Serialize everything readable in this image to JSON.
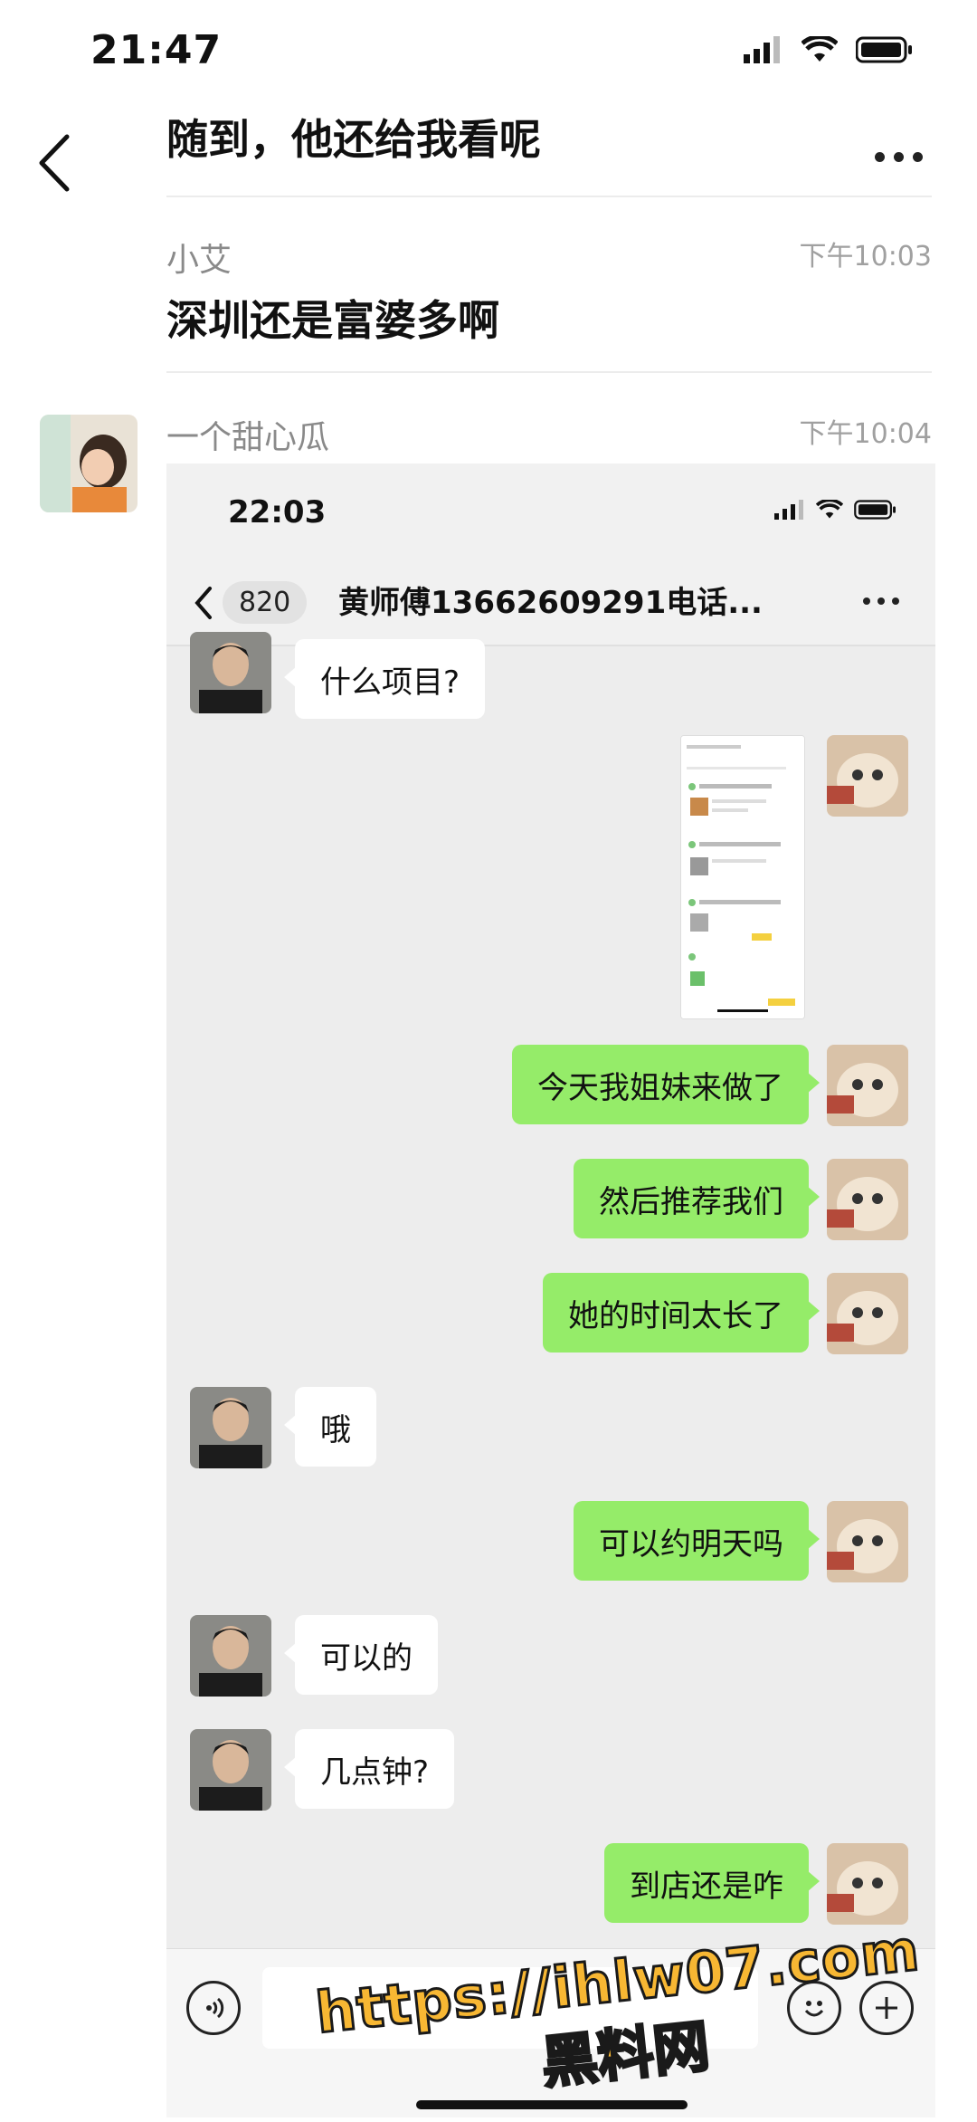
{
  "status_bar": {
    "time": "21:47"
  },
  "header": {
    "title": "随到，他还给我看呢"
  },
  "messages": [
    {
      "sender": "小艾",
      "time": "下午10:03",
      "text": "深圳还是富婆多啊"
    },
    {
      "sender": "一个甜心瓜",
      "time": "下午10:04"
    }
  ],
  "screenshot": {
    "time": "22:03",
    "back_count": "820",
    "title": "黄师傅13662609291电话...",
    "chat": [
      {
        "from": "other",
        "text": "什么项目?"
      },
      {
        "from": "me",
        "text": "今天我姐妹来做了"
      },
      {
        "from": "me",
        "text": "然后推荐我们"
      },
      {
        "from": "me",
        "text": "她的时间太长了"
      },
      {
        "from": "other",
        "text": "哦"
      },
      {
        "from": "me",
        "text": "可以约明天吗"
      },
      {
        "from": "other",
        "text": "可以的"
      },
      {
        "from": "other",
        "text": "几点钟?"
      },
      {
        "from": "me",
        "text": "到店还是咋"
      }
    ]
  },
  "watermark": {
    "url": "https://ihlw07.com",
    "name": "黑料网"
  },
  "colors": {
    "green_bubble": "#95ec69",
    "chat_bg": "#ededed",
    "watermark": "#f7b733"
  }
}
